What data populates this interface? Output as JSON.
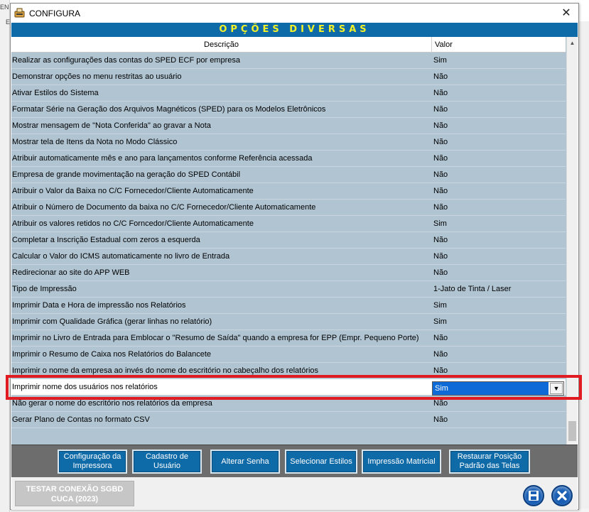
{
  "background": {
    "left_text_1": "EN",
    "left_text_2": "E"
  },
  "window": {
    "title": "CONFIGURA",
    "close_glyph": "✕"
  },
  "section_title": "OPÇÕES DIVERSAS",
  "table": {
    "headers": {
      "description": "Descrição",
      "value": "Valor"
    },
    "rows": [
      {
        "description": "Realizar as configurações das contas do SPED ECF por empresa",
        "value": "Sim"
      },
      {
        "description": "Demonstrar opções no menu restritas ao usuário",
        "value": "Não"
      },
      {
        "description": "Ativar Estilos do Sistema",
        "value": "Não"
      },
      {
        "description": "Formatar Série na Geração dos Arquivos Magnéticos (SPED) para os Modelos Eletrônicos",
        "value": "Não"
      },
      {
        "description": "Mostrar mensagem de \"Nota Conferida\" ao gravar a Nota",
        "value": "Não"
      },
      {
        "description": "Mostrar tela de Itens da Nota no Modo Clássico",
        "value": "Não"
      },
      {
        "description": "Atribuir automaticamente mês e ano para lançamentos conforme Referência acessada",
        "value": "Não"
      },
      {
        "description": "Empresa de grande movimentação na geração do SPED Contábil",
        "value": "Não"
      },
      {
        "description": "Atribuir o Valor da Baixa no C/C Fornecedor/Cliente Automaticamente",
        "value": "Não"
      },
      {
        "description": "Atribuir o Número de Documento da baixa no C/C Fornecedor/Cliente Automaticamente",
        "value": "Não"
      },
      {
        "description": "Atribuir os valores retidos no C/C Forncedor/Cliente Automaticamente",
        "value": "Sim"
      },
      {
        "description": "Completar a Inscrição Estadual com zeros a esquerda",
        "value": "Não"
      },
      {
        "description": "Calcular o Valor do ICMS automaticamente no livro de Entrada",
        "value": "Não"
      },
      {
        "description": "Redirecionar ao site do APP WEB",
        "value": "Não"
      },
      {
        "description": "Tipo de Impressão",
        "value": "1-Jato de Tinta / Laser"
      },
      {
        "description": "Imprimir Data e Hora de impressão nos Relatórios",
        "value": "Sim"
      },
      {
        "description": "Imprimir com Qualidade Gráfica (gerar linhas no relatório)",
        "value": "Sim"
      },
      {
        "description": "Imprimir no Livro de Entrada para Emblocar o \"Resumo de Saída\" quando a empresa for EPP (Empr. Pequeno Porte)",
        "value": "Não"
      },
      {
        "description": "Imprimir o Resumo de Caixa nos Relatórios do Balancete",
        "value": "Não"
      },
      {
        "description": "Imprimir o nome da empresa ao invés do nome do escritório no cabeçalho dos relatórios",
        "value": "Não"
      },
      {
        "description": "Imprimir nome dos usuários nos relatórios",
        "value": "Sim"
      },
      {
        "description": "Não gerar o nome do escritório nos relatórios da empresa",
        "value": "Não"
      },
      {
        "description": "Gerar Plano de Contas no formato CSV",
        "value": "Não"
      }
    ],
    "selected_row_index": 20
  },
  "buttons": {
    "config_impressora": "Configuração da Impressora",
    "cadastro_usuario": "Cadastro de Usuário",
    "alterar_senha": "Alterar Senha",
    "selecionar_estilos": "Selecionar Estilos",
    "impressao_matricial": "Impressão Matricial",
    "restaurar_posicao": "Restaurar Posição Padrão das Telas"
  },
  "footer": {
    "test_connection": "TESTAR CONEXÃO SGBD CUCA (2023)"
  },
  "colors": {
    "header_band": "#0f6aa8",
    "header_text": "#f5f227",
    "grid_bg": "#b0c4d2",
    "highlight": "#e11b22",
    "selection": "#0d6ad6"
  },
  "icons": [
    "app-icon",
    "close-icon",
    "dropdown-arrow-icon",
    "save-icon",
    "exit-icon"
  ]
}
